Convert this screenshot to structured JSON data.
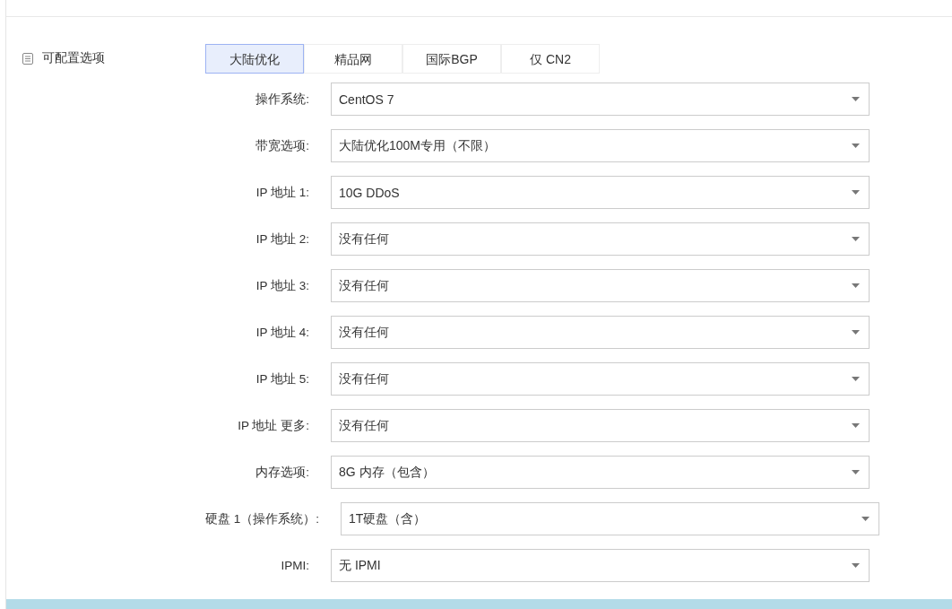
{
  "section": {
    "title": "可配置选项"
  },
  "tabs": [
    {
      "label": "大陆优化",
      "selected": true
    },
    {
      "label": "精品网",
      "selected": false
    },
    {
      "label": "国际BGP",
      "selected": false
    },
    {
      "label": "仅 CN2",
      "selected": false
    }
  ],
  "options": [
    {
      "label": "操作系统:",
      "value": "CentOS 7"
    },
    {
      "label": "带宽选项:",
      "value": "大陆优化100M专用（不限）"
    },
    {
      "label": "IP 地址 1:",
      "value": "10G DDoS"
    },
    {
      "label": "IP 地址 2:",
      "value": "没有任何"
    },
    {
      "label": "IP 地址 3:",
      "value": "没有任何"
    },
    {
      "label": "IP 地址 4:",
      "value": "没有任何"
    },
    {
      "label": "IP 地址 5:",
      "value": "没有任何"
    },
    {
      "label": "IP 地址 更多:",
      "value": "没有任何"
    },
    {
      "label": "内存选项:",
      "value": "8G 内存（包含）"
    },
    {
      "label": "硬盘 1（操作系统）:",
      "value": "1T硬盘（含）"
    },
    {
      "label": "IPMI:",
      "value": "无 IPMI"
    }
  ]
}
